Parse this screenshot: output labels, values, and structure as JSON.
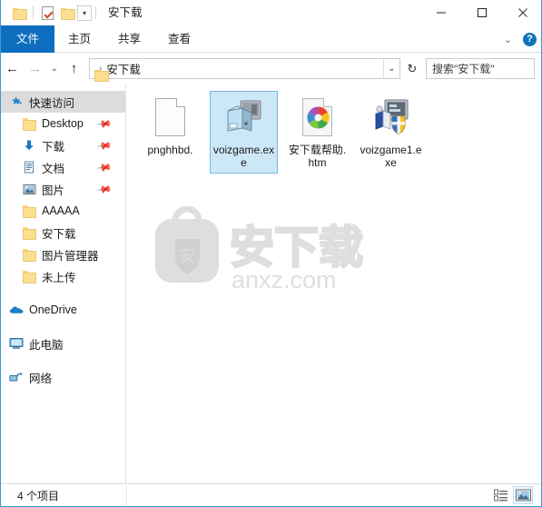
{
  "titlebar": {
    "title": "安下载",
    "quick_access": [
      {
        "name": "folder-icon",
        "label": "新建文件夹"
      },
      {
        "name": "properties-icon",
        "label": "属性"
      },
      {
        "name": "folder-icon-2",
        "label": "文件夹"
      },
      {
        "name": "chevron-down-icon",
        "label": "自定义快速访问工具栏"
      }
    ],
    "minimize": "—",
    "maximize": "☐",
    "close": "✕"
  },
  "ribbon": {
    "tabs": [
      {
        "label": "文件",
        "active": true
      },
      {
        "label": "主页",
        "active": false
      },
      {
        "label": "共享",
        "active": false
      },
      {
        "label": "查看",
        "active": false
      }
    ],
    "collapse_icon": "⌄",
    "help_label": "?"
  },
  "navbar": {
    "back": "←",
    "forward": "→",
    "recent": "⌄",
    "up": "↑",
    "address_crumb": "安下载",
    "address_sep": "›",
    "address_chevron": "⌄",
    "refresh": "↻",
    "search_placeholder": "搜索\"安下载\""
  },
  "sidebar": {
    "items": [
      {
        "label": "快速访问",
        "icon": "star-pin-icon",
        "selected": true,
        "indent": false,
        "pinned": false
      },
      {
        "label": "Desktop",
        "icon": "folder-icon",
        "selected": false,
        "indent": true,
        "pinned": true
      },
      {
        "label": "下载",
        "icon": "downloads-icon",
        "selected": false,
        "indent": true,
        "pinned": true
      },
      {
        "label": "文档",
        "icon": "documents-icon",
        "selected": false,
        "indent": true,
        "pinned": true
      },
      {
        "label": "图片",
        "icon": "pictures-icon",
        "selected": false,
        "indent": true,
        "pinned": true
      },
      {
        "label": "AAAAA",
        "icon": "folder-icon",
        "selected": false,
        "indent": true,
        "pinned": false
      },
      {
        "label": "安下载",
        "icon": "folder-icon",
        "selected": false,
        "indent": true,
        "pinned": false
      },
      {
        "label": "图片管理器",
        "icon": "folder-icon",
        "selected": false,
        "indent": true,
        "pinned": false
      },
      {
        "label": "未上传",
        "icon": "folder-icon",
        "selected": false,
        "indent": true,
        "pinned": false
      }
    ],
    "groups": [
      {
        "label": "OneDrive",
        "icon": "onedrive-cloud-icon"
      },
      {
        "label": "此电脑",
        "icon": "this-pc-monitor-icon"
      },
      {
        "label": "网络",
        "icon": "network-icon"
      }
    ]
  },
  "files": [
    {
      "name": "pnghhbd.",
      "icon": "blank-document-icon",
      "selected": false
    },
    {
      "name": "voizgame.exe",
      "icon": "setup-exe-icon",
      "selected": true
    },
    {
      "name": "安下载帮助.htm",
      "icon": "html-chrome-icon",
      "selected": false
    },
    {
      "name": "voizgame1.exe",
      "icon": "installer-shield-icon",
      "selected": false
    }
  ],
  "watermark": {
    "text": "安下载",
    "url": "anxz.com",
    "badge": "安"
  },
  "statusbar": {
    "count": "4 个项目",
    "views": [
      {
        "name": "details-view-icon",
        "active": false
      },
      {
        "name": "large-icons-view-icon",
        "active": true
      }
    ]
  },
  "colors": {
    "accent": "#0d6ebf",
    "selection_fill": "#cce8f7",
    "selection_border": "#7bb5dd",
    "window_border": "#3a9bd5",
    "folder_yellow": "#fcdf8e"
  }
}
